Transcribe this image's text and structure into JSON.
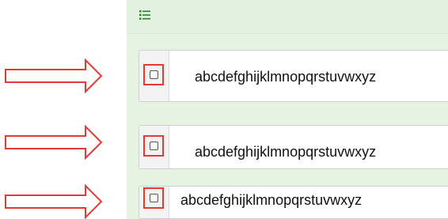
{
  "toolbar": {
    "icon": "list-icon"
  },
  "rows": [
    {
      "label": "abcdefghijklmnopqrstuvwxyz",
      "checked": false
    },
    {
      "label": "abcdefghijklmnopqrstuvwxyz",
      "checked": false
    },
    {
      "label": "abcdefghijklmnopqrstuvwxyz",
      "checked": false
    }
  ],
  "annotations": {
    "arrow_color": "#e53935",
    "highlight_color": "#e53935",
    "arrow_icon": "right-arrow-outline-icon"
  },
  "colors": {
    "panel_bg": "#e6f3e3",
    "row_bg": "#ffffff",
    "handle_bg": "#f3f3f3"
  }
}
